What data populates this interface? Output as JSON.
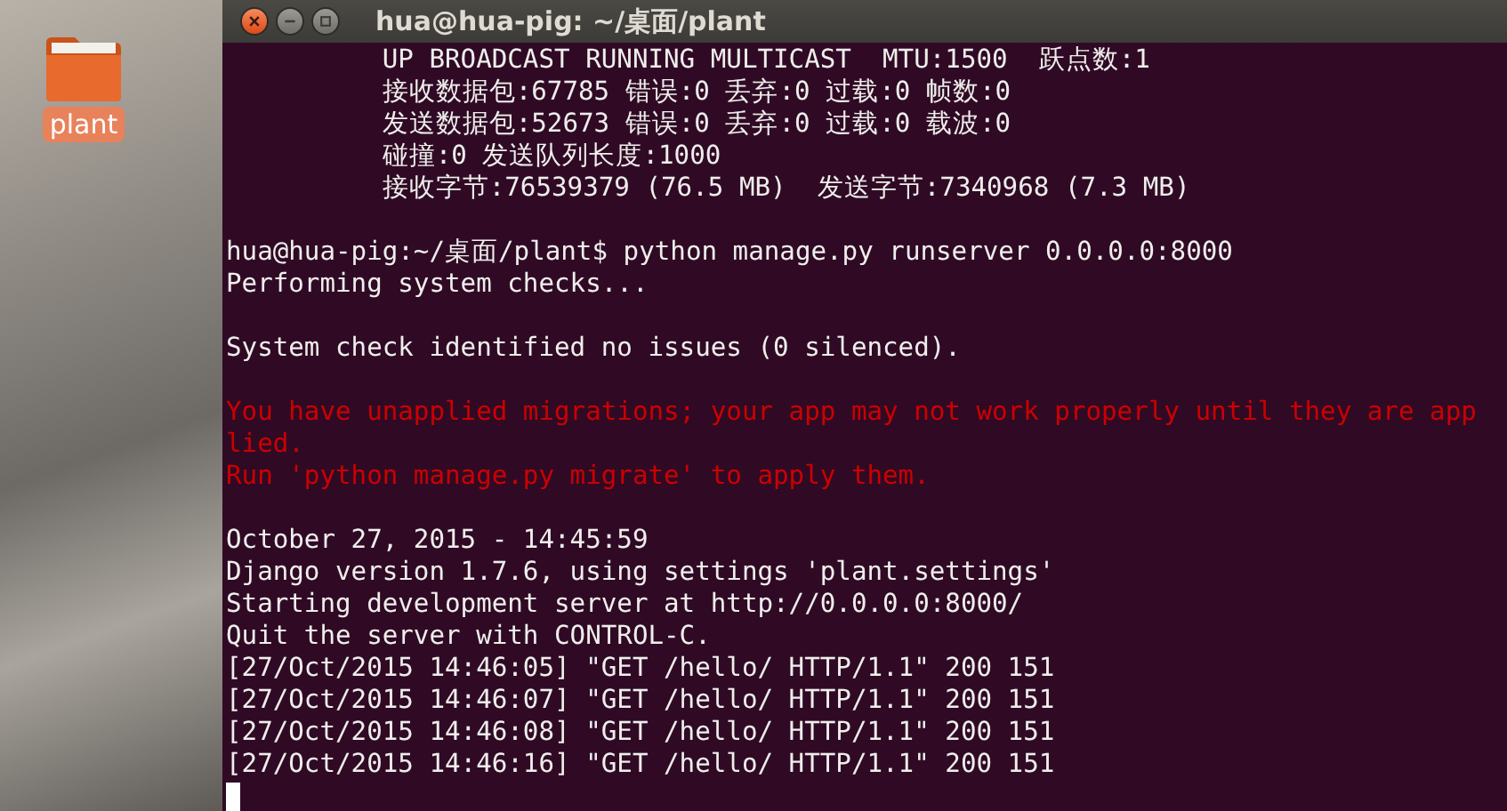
{
  "desktop": {
    "icons": [
      {
        "label": "plant"
      }
    ]
  },
  "window": {
    "title": "hua@hua-pig: ~/桌面/plant"
  },
  "terminal": {
    "lines": [
      {
        "kind": "output",
        "text": "          UP BROADCAST RUNNING MULTICAST  MTU:1500  跃点数:1"
      },
      {
        "kind": "output",
        "text": "          接收数据包:67785 错误:0 丢弃:0 过载:0 帧数:0"
      },
      {
        "kind": "output",
        "text": "          发送数据包:52673 错误:0 丢弃:0 过载:0 载波:0"
      },
      {
        "kind": "output",
        "text": "          碰撞:0 发送队列长度:1000"
      },
      {
        "kind": "output",
        "text": "          接收字节:76539379 (76.5 MB)  发送字节:7340968 (7.3 MB)"
      },
      {
        "kind": "blank"
      },
      {
        "kind": "output",
        "text": "hua@hua-pig:~/桌面/plant$ python manage.py runserver 0.0.0.0:8000"
      },
      {
        "kind": "output",
        "text": "Performing system checks..."
      },
      {
        "kind": "blank"
      },
      {
        "kind": "output",
        "text": "System check identified no issues (0 silenced)."
      },
      {
        "kind": "blank"
      },
      {
        "kind": "error",
        "text": "You have unapplied migrations; your app may not work properly until they are app"
      },
      {
        "kind": "error",
        "text": "lied."
      },
      {
        "kind": "error",
        "text": "Run 'python manage.py migrate' to apply them."
      },
      {
        "kind": "blank"
      },
      {
        "kind": "output",
        "text": "October 27, 2015 - 14:45:59"
      },
      {
        "kind": "output",
        "text": "Django version 1.7.6, using settings 'plant.settings'"
      },
      {
        "kind": "output",
        "text": "Starting development server at http://0.0.0.0:8000/"
      },
      {
        "kind": "output",
        "text": "Quit the server with CONTROL-C."
      },
      {
        "kind": "output",
        "text": "[27/Oct/2015 14:46:05] \"GET /hello/ HTTP/1.1\" 200 151"
      },
      {
        "kind": "output",
        "text": "[27/Oct/2015 14:46:07] \"GET /hello/ HTTP/1.1\" 200 151"
      },
      {
        "kind": "output",
        "text": "[27/Oct/2015 14:46:08] \"GET /hello/ HTTP/1.1\" 200 151"
      },
      {
        "kind": "output",
        "text": "[27/Oct/2015 14:46:16] \"GET /hello/ HTTP/1.1\" 200 151"
      },
      {
        "kind": "cursor"
      }
    ]
  }
}
